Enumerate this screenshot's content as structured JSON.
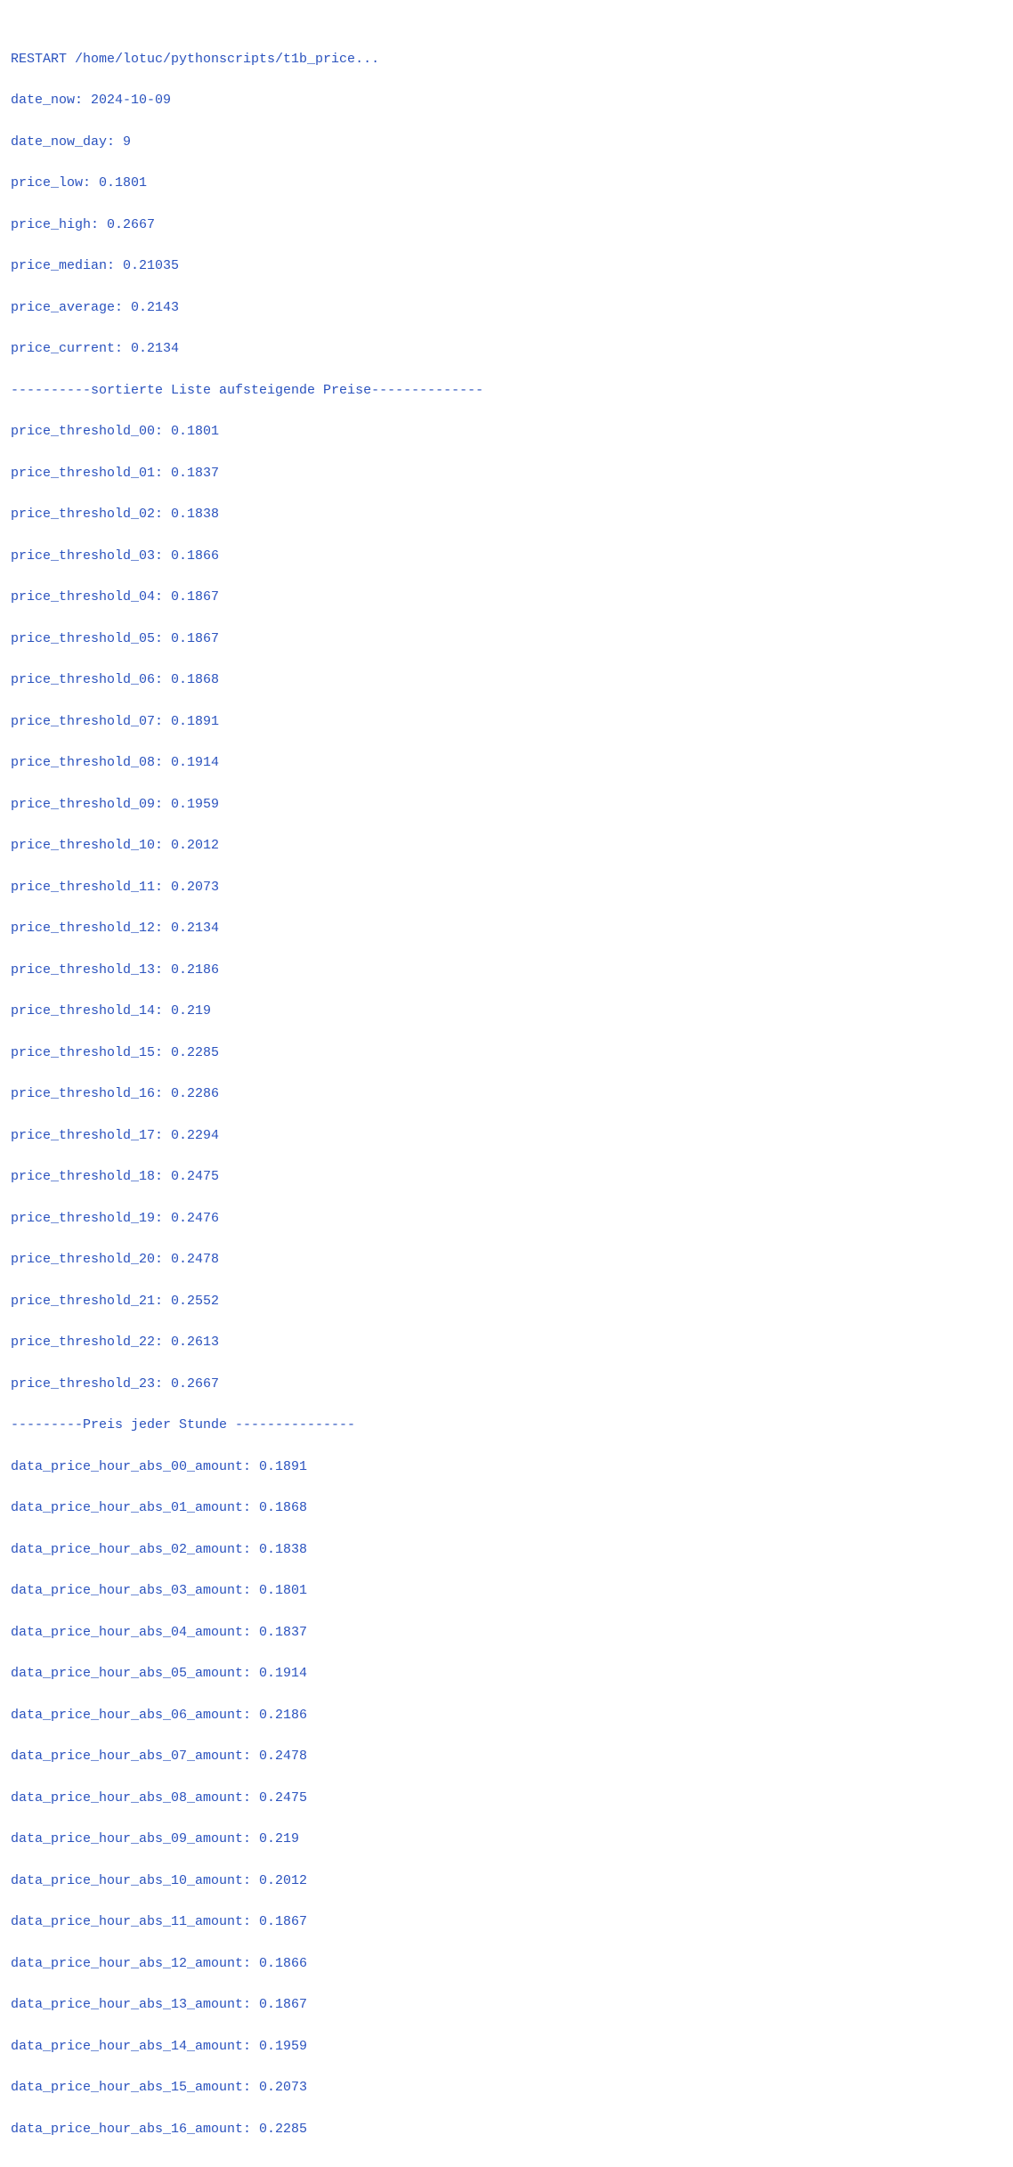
{
  "terminal": {
    "header": "RESTART /home/lotuc/pythonscripts/t1b_price...",
    "lines": [
      "date_now: 2024-10-09",
      "date_now_day: 9",
      "price_low: 0.1801",
      "price_high: 0.2667",
      "price_median: 0.21035",
      "price_average: 0.2143",
      "price_current: 0.2134",
      "----------sortierte Liste aufsteigende Preise--------------",
      "price_threshold_00: 0.1801",
      "price_threshold_01: 0.1837",
      "price_threshold_02: 0.1838",
      "price_threshold_03: 0.1866",
      "price_threshold_04: 0.1867",
      "price_threshold_05: 0.1867",
      "price_threshold_06: 0.1868",
      "price_threshold_07: 0.1891",
      "price_threshold_08: 0.1914",
      "price_threshold_09: 0.1959",
      "price_threshold_10: 0.2012",
      "price_threshold_11: 0.2073",
      "price_threshold_12: 0.2134",
      "price_threshold_13: 0.2186",
      "price_threshold_14: 0.219",
      "price_threshold_15: 0.2285",
      "price_threshold_16: 0.2286",
      "price_threshold_17: 0.2294",
      "price_threshold_18: 0.2475",
      "price_threshold_19: 0.2476",
      "price_threshold_20: 0.2478",
      "price_threshold_21: 0.2552",
      "price_threshold_22: 0.2613",
      "price_threshold_23: 0.2667",
      "---------Preis jeder Stunde ---------------",
      "data_price_hour_abs_00_amount: 0.1891",
      "data_price_hour_abs_01_amount: 0.1868",
      "data_price_hour_abs_02_amount: 0.1838",
      "data_price_hour_abs_03_amount: 0.1801",
      "data_price_hour_abs_04_amount: 0.1837",
      "data_price_hour_abs_05_amount: 0.1914",
      "data_price_hour_abs_06_amount: 0.2186",
      "data_price_hour_abs_07_amount: 0.2478",
      "data_price_hour_abs_08_amount: 0.2475",
      "data_price_hour_abs_09_amount: 0.219",
      "data_price_hour_abs_10_amount: 0.2012",
      "data_price_hour_abs_11_amount: 0.1867",
      "data_price_hour_abs_12_amount: 0.1866",
      "data_price_hour_abs_13_amount: 0.1867",
      "data_price_hour_abs_14_amount: 0.1959",
      "data_price_hour_abs_15_amount: 0.2073",
      "data_price_hour_abs_16_amount: 0.2285"
    ]
  }
}
